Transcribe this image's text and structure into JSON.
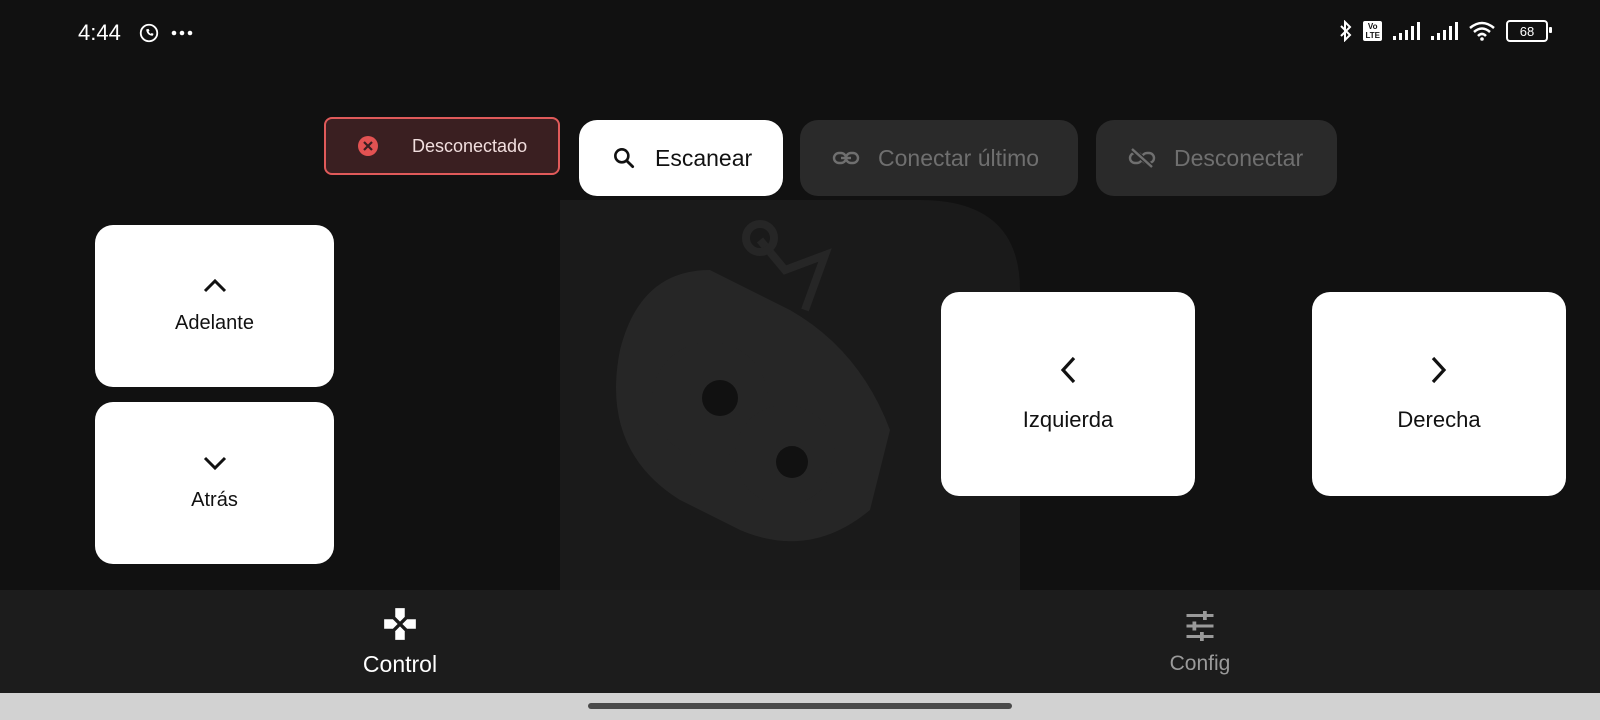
{
  "status_bar": {
    "time": "4:44",
    "left_icons": [
      "whatsapp-icon",
      "more-dots-icon"
    ],
    "right_icons": [
      "bluetooth-icon",
      "volte-icon",
      "signal-icon",
      "signal-icon",
      "wifi-icon",
      "battery-icon"
    ],
    "vo_lte_top": "Vo",
    "vo_lte_bottom": "LTE",
    "battery_level": "68"
  },
  "connection": {
    "status_label": "Desconectado",
    "status_color": "#e05a5a",
    "scan_label": "Escanear",
    "connect_last_label": "Conectar último",
    "disconnect_label": "Desconectar"
  },
  "controls": {
    "forward_label": "Adelante",
    "back_label": "Atrás",
    "left_label": "Izquierda",
    "right_label": "Derecha"
  },
  "bottom_nav": {
    "items": [
      {
        "label": "Control",
        "icon": "gamepad-icon",
        "selected": true
      },
      {
        "label": "Config",
        "icon": "tune-icon",
        "selected": false
      }
    ]
  }
}
